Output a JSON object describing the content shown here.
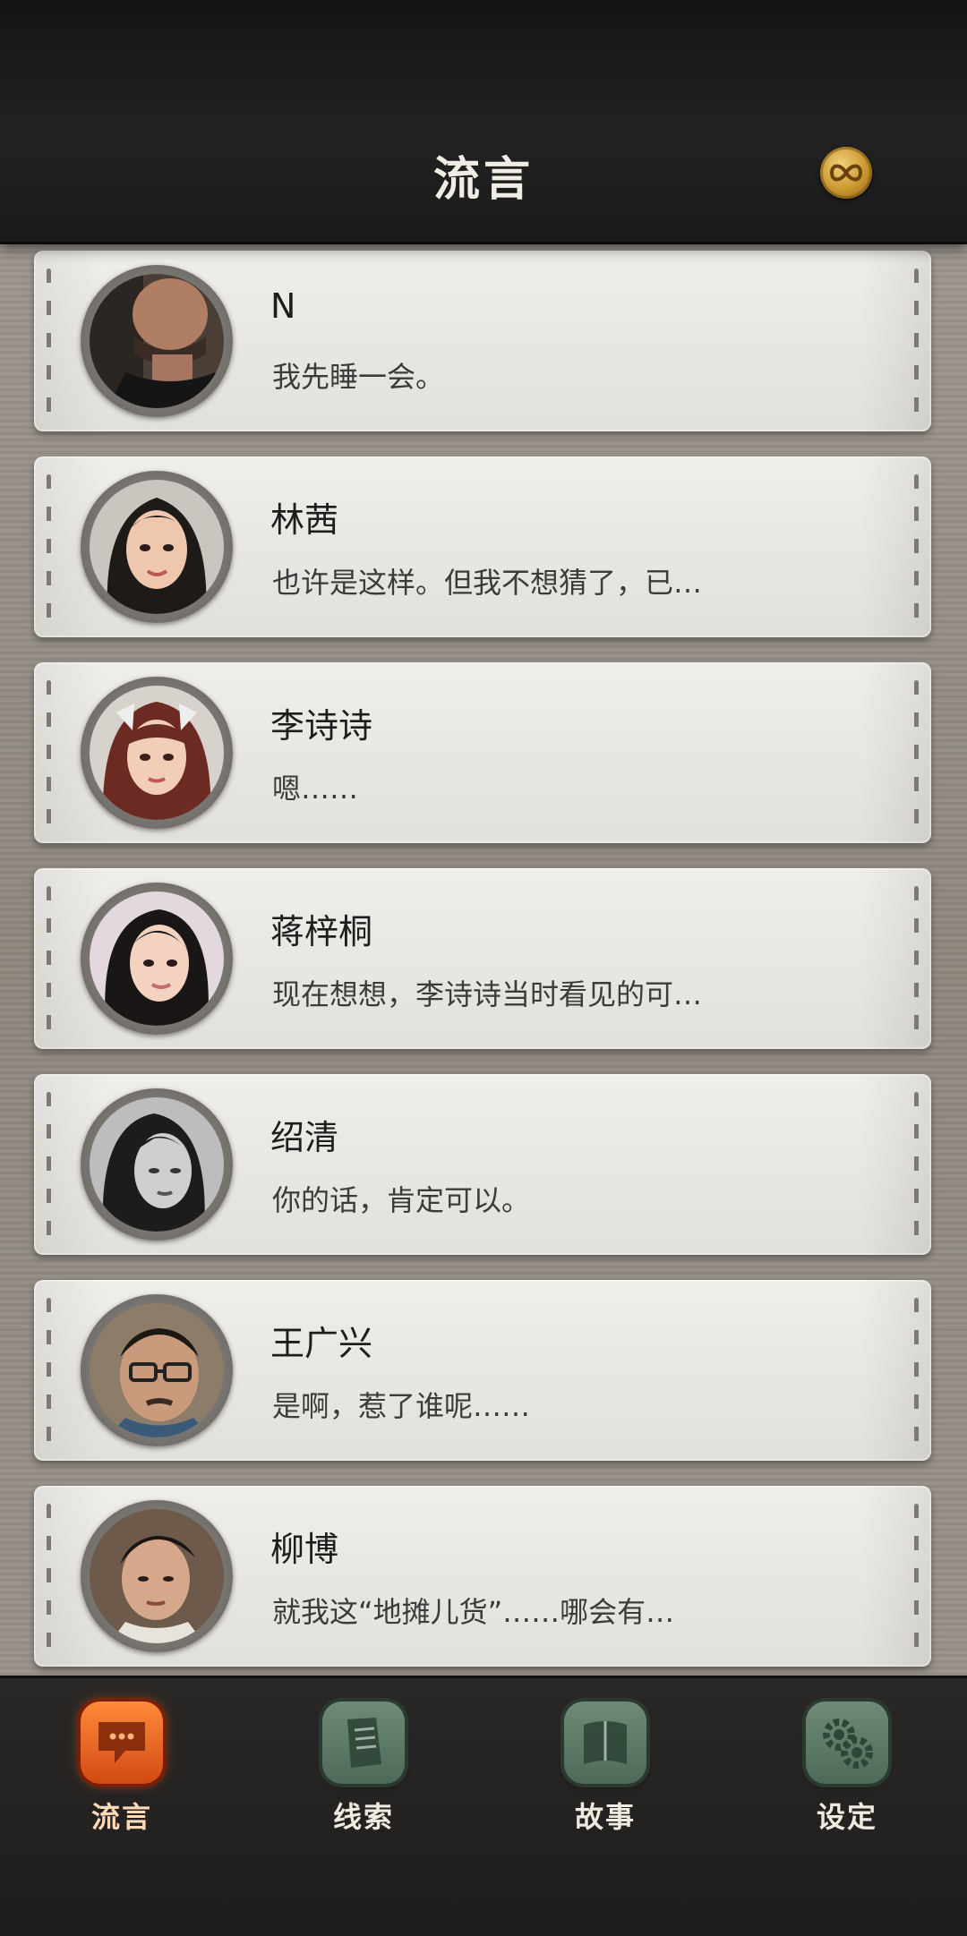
{
  "header": {
    "title": "流言",
    "coin_icon": "infinity-coin-icon"
  },
  "contacts": [
    {
      "name": "N",
      "message": "我先睡一会。"
    },
    {
      "name": "林茜",
      "message": "也许是这样。但我不想猜了，已…"
    },
    {
      "name": "李诗诗",
      "message": "嗯……"
    },
    {
      "name": "蒋梓桐",
      "message": "现在想想，李诗诗当时看见的可…"
    },
    {
      "name": "绍清",
      "message": "你的话，肯定可以。"
    },
    {
      "name": "王广兴",
      "message": "是啊，惹了谁呢……"
    },
    {
      "name": "柳博",
      "message": "就我这“地摊儿货”……哪会有…"
    }
  ],
  "nav": {
    "items": [
      {
        "label": "流言",
        "icon": "chat-bubble-icon",
        "active": true
      },
      {
        "label": "线索",
        "icon": "document-icon",
        "active": false
      },
      {
        "label": "故事",
        "icon": "book-icon",
        "active": false
      },
      {
        "label": "设定",
        "icon": "gears-icon",
        "active": false
      }
    ]
  },
  "colors": {
    "active_accent": "#e8621e",
    "inactive_tab": "#5e7c68"
  }
}
